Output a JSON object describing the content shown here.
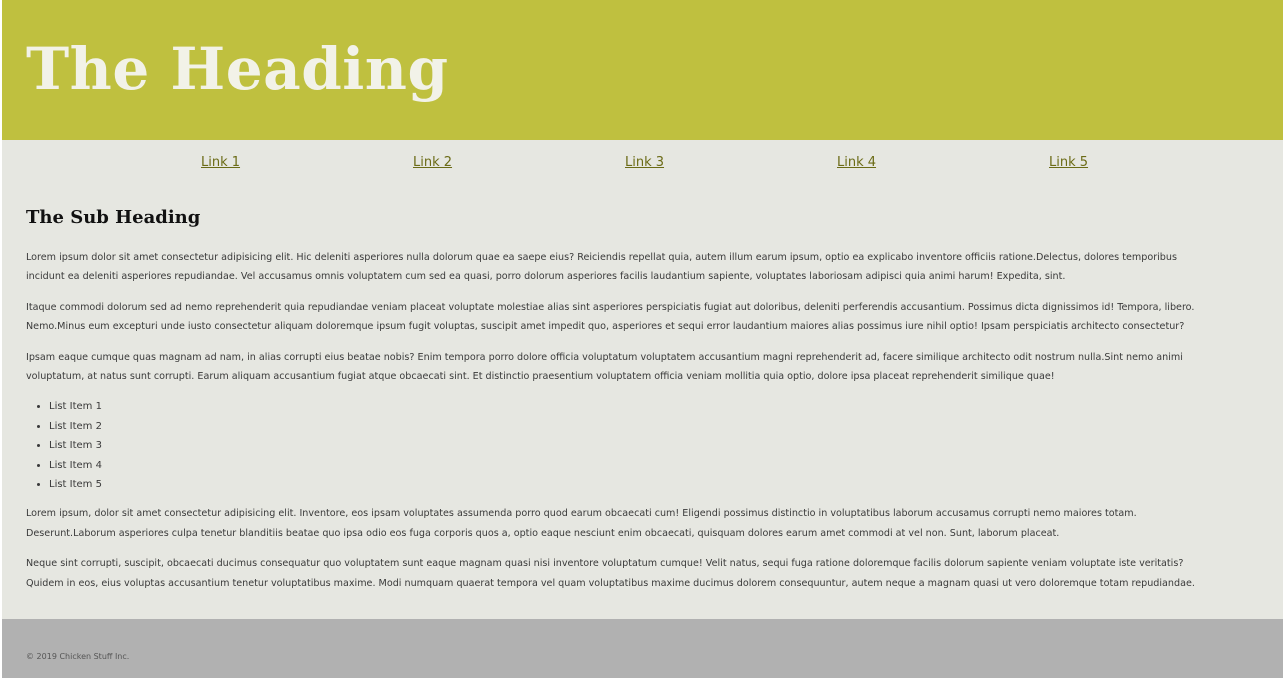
{
  "header": {
    "title": "The Heading"
  },
  "nav": {
    "links": [
      "Link 1",
      "Link 2",
      "Link 3",
      "Link 4",
      "Link 5"
    ]
  },
  "main": {
    "subheading": "The Sub Heading",
    "paragraphs": [
      [
        "Lorem ipsum dolor sit amet consectetur adipisicing elit. Hic deleniti asperiores nulla dolorum quae ea saepe eius? Reiciendis repellat quia, autem illum earum ipsum, optio ea explicabo inventore officiis ratione.Delectus, dolores temporibus",
        "incidunt ea deleniti asperiores repudiandae. Vel accusamus omnis voluptatem cum sed ea quasi, porro dolorum asperiores facilis laudantium sapiente, voluptates laboriosam adipisci quia animi harum! Expedita, sint."
      ],
      [
        "Itaque commodi dolorum sed ad nemo reprehenderit quia repudiandae veniam placeat voluptate molestiae alias sint asperiores perspiciatis fugiat aut doloribus, deleniti perferendis accusantium. Possimus dicta dignissimos id! Tempora, libero.",
        "Nemo.Minus eum excepturi unde iusto consectetur aliquam doloremque ipsum fugit voluptas, suscipit amet impedit quo, asperiores et sequi error laudantium maiores alias possimus iure nihil optio! Ipsam perspiciatis architecto consectetur?"
      ],
      [
        "Ipsam eaque cumque quas magnam ad nam, in alias corrupti eius beatae nobis? Enim tempora porro dolore officia voluptatum voluptatem accusantium magni reprehenderit ad, facere similique architecto odit nostrum nulla.Sint nemo animi",
        "voluptatum, at natus sunt corrupti. Earum aliquam accusantium fugiat atque obcaecati sint. Et distinctio praesentium voluptatem officia veniam mollitia quia optio, dolore ipsa placeat reprehenderit similique quae!"
      ]
    ],
    "list_items": [
      "List Item 1",
      "List Item 2",
      "List Item 3",
      "List Item 4",
      "List Item 5"
    ],
    "paragraphs_after": [
      [
        "Lorem ipsum, dolor sit amet consectetur adipisicing elit. Inventore, eos ipsam voluptates assumenda porro quod earum obcaecati cum! Eligendi possimus distinctio in voluptatibus laborum accusamus corrupti nemo maiores totam.",
        "Deserunt.Laborum asperiores culpa tenetur blanditiis beatae quo ipsa odio eos fuga corporis quos a, optio eaque nesciunt enim obcaecati, quisquam dolores earum amet commodi at vel non. Sunt, laborum placeat."
      ],
      [
        "Neque sint corrupti, suscipit, obcaecati ducimus consequatur quo voluptatem sunt eaque magnam quasi nisi inventore voluptatum cumque! Velit natus, sequi fuga ratione doloremque facilis dolorum sapiente veniam voluptate iste veritatis?",
        "Quidem in eos, eius voluptas accusantium tenetur voluptatibus maxime. Modi numquam quaerat tempora vel quam voluptatibus maxime ducimus dolorem consequuntur, autem neque a magnam quasi ut vero doloremque totam repudiandae."
      ]
    ]
  },
  "footer": {
    "copyright": "© 2019 Chicken Stuff Inc."
  },
  "colors": {
    "header_bg": "#bfc03f",
    "page_bg": "#e6e7e1",
    "footer_bg": "#b1b1b1",
    "link": "#6b6b16"
  }
}
